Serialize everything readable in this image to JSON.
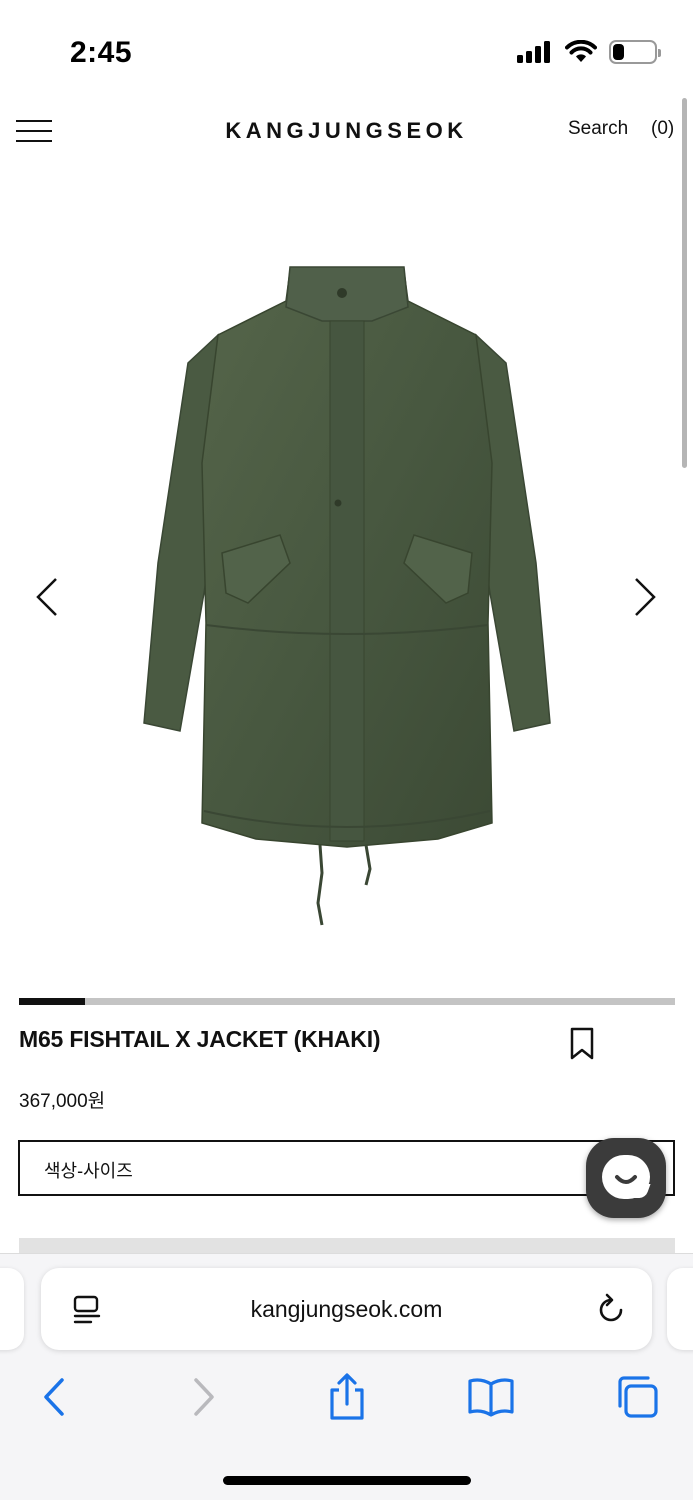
{
  "status_bar": {
    "time": "2:45",
    "battery_level": 0.25
  },
  "header": {
    "brand": "KANGJUNGSEOK",
    "search_label": "Search",
    "cart_label": "(0)"
  },
  "gallery": {
    "current_slide_fraction": 0.1,
    "icons": {
      "prev": "chevron-left-icon",
      "next": "chevron-right-icon"
    }
  },
  "product": {
    "title": "M65 FISHTAIL X JACKET (KHAKI)",
    "price": "367,000원",
    "option_label": "색상-사이즈",
    "jacket_color": "#4b5a41"
  },
  "browser": {
    "url": "kangjungseok.com",
    "icons": [
      "reader-icon",
      "reload-icon",
      "back-icon",
      "forward-icon",
      "share-icon",
      "bookmarks-icon",
      "tabs-icon"
    ],
    "accent_color": "#1a73e8"
  }
}
